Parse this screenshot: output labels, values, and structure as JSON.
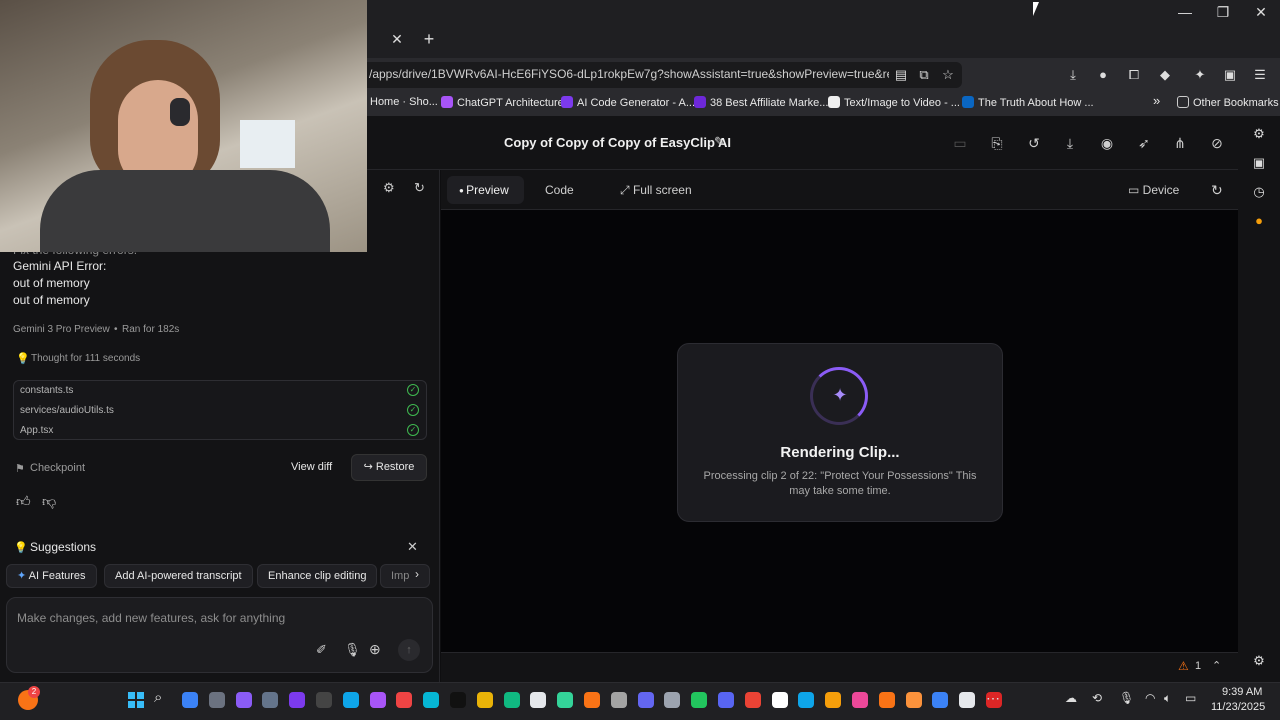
{
  "browser": {
    "url": "/apps/drive/1BVWRv6AI-HcE6FiYSO6-dLp1rokpEw7g?showAssistant=true&showPreview=true&resour",
    "tab_close": "✕",
    "new_tab": "+",
    "bookmarks": [
      {
        "label": "Home · Sho...",
        "color": "#444"
      },
      {
        "label": "ChatGPT Architecture",
        "color": "#a855f7"
      },
      {
        "label": "AI Code Generator - A...",
        "color": "#7c3aed"
      },
      {
        "label": "38 Best Affiliate Marke...",
        "color": "#6d28d9"
      },
      {
        "label": "Text/Image to Video - ...",
        "color": "#ffffff"
      },
      {
        "label": "The Truth About How ...",
        "color": "#0a66c2"
      }
    ],
    "bookmark_more": "»",
    "other_bookmarks": "Other Bookmarks"
  },
  "app": {
    "title": "Copy of Copy of Copy of EasyClip AI"
  },
  "chat": {
    "error_partial": "Fix the following errors:",
    "error_lines": [
      "Gemini API Error:",
      "out of memory",
      "out of memory"
    ],
    "model": "Gemini 3 Pro Preview",
    "ran_for": "Ran for 182s",
    "thought": "Thought for 111 seconds",
    "files": [
      "constants.ts",
      "services/audioUtils.ts",
      "App.tsx"
    ],
    "checkpoint": "Checkpoint",
    "view_diff": "View diff",
    "restore": "Restore",
    "suggestions_title": "Suggestions",
    "suggestions": [
      "AI Features",
      "Add AI-powered transcript",
      "Enhance clip editing",
      "Imp"
    ],
    "prompt_placeholder": "Make changes, add new features, ask for anything"
  },
  "preview": {
    "tabs": [
      "Preview",
      "Code",
      "Full screen"
    ],
    "device": "Device",
    "modal_title": "Rendering Clip...",
    "modal_desc": "Processing clip 2 of 22: \"Protect Your Possessions\" This may take some time.",
    "warnings_count": "1"
  },
  "taskbar": {
    "badge": "2",
    "time": "9:39 AM",
    "date": "11/23/2025",
    "app_colors": [
      "#3b82f6",
      "#6b7280",
      "#8b5cf6",
      "#64748b",
      "#7c3aed",
      "#444",
      "#0ea5e9",
      "#a855f7",
      "#ef4444",
      "#06b6d4",
      "#111",
      "#eab308",
      "#10b981",
      "#e5e7eb",
      "#34d399",
      "#f97316",
      "#a3a3a3",
      "#6366f1",
      "#9ca3af",
      "#22c55e",
      "#5865f2",
      "#ea4335",
      "#ffffff",
      "#0ea5e9",
      "#f59e0b",
      "#ec4899",
      "#f97316",
      "#fb923c",
      "#3b82f6",
      "#e5e7eb",
      "#dc2626"
    ]
  }
}
